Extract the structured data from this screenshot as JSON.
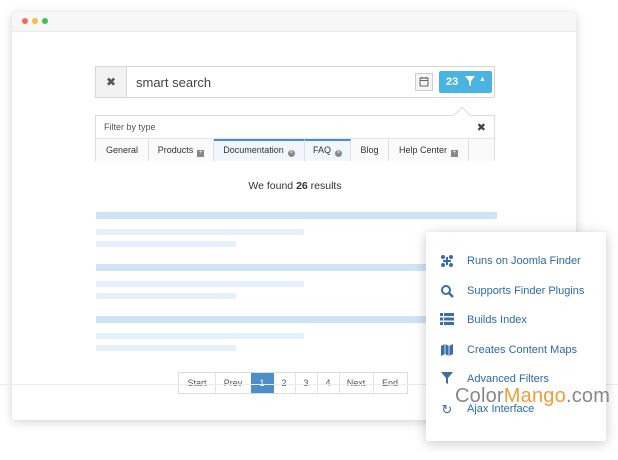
{
  "window": {
    "controls": [
      "close",
      "minimize",
      "maximize"
    ]
  },
  "search": {
    "clear_icon": "close-icon",
    "value": "smart search",
    "calendar_icon": "calendar-icon",
    "filter_count": "23",
    "filter_icon": "filter-icon",
    "caret_icon": "caret-up-icon"
  },
  "filter_panel": {
    "title": "Filter by type",
    "close_icon": "close-icon",
    "tabs": [
      {
        "label": "General",
        "icon": null
      },
      {
        "label": "Products",
        "icon": "plus-icon"
      },
      {
        "label": "Documentation",
        "icon": "remove-icon"
      },
      {
        "label": "FAQ",
        "icon": "remove-icon"
      },
      {
        "label": "Blog",
        "icon": null
      },
      {
        "label": "Help Center",
        "icon": "plus-icon"
      }
    ]
  },
  "results": {
    "prefix": "We found ",
    "count": "26",
    "suffix": " results"
  },
  "pagination": {
    "items": [
      "Start",
      "Prev",
      "1",
      "2",
      "3",
      "4",
      "Next",
      "End"
    ],
    "active": "1"
  },
  "features": [
    {
      "icon": "joomla-icon",
      "label": "Runs on Joomla Finder"
    },
    {
      "icon": "search-icon",
      "label": "Supports Finder Plugins"
    },
    {
      "icon": "list-icon",
      "label": "Builds Index"
    },
    {
      "icon": "map-icon",
      "label": "Creates Content Maps"
    },
    {
      "icon": "filter-icon",
      "label": "Advanced Filters"
    },
    {
      "icon": "refresh-icon",
      "label": "Ajax Interface"
    }
  ],
  "watermark": {
    "part1": "Color",
    "part2": "Mango",
    "part3": ".com"
  },
  "colors": {
    "accent": "#4ab3e0",
    "active_page": "#4a8fc8",
    "feature_text": "#2d6aa3",
    "skeleton": "#cfe3f6"
  }
}
